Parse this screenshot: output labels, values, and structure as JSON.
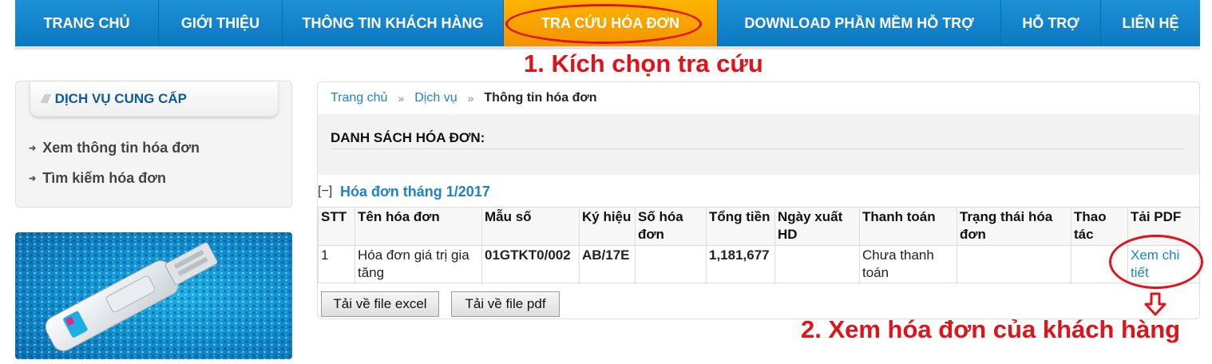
{
  "nav": {
    "items": [
      {
        "label": "TRANG CHỦ"
      },
      {
        "label": "GIỚI THIỆU"
      },
      {
        "label": "THÔNG TIN KHÁCH HÀNG"
      },
      {
        "label": "TRA CỨU HÓA ĐƠN"
      },
      {
        "label": "DOWNLOAD PHẦN MỀM HỖ TRỢ"
      },
      {
        "label": "HỖ TRỢ"
      },
      {
        "label": "LIÊN HỆ"
      }
    ],
    "active_index": 3
  },
  "annotations": {
    "step1": "1. Kích chọn tra cứu",
    "step2": "2. Xem hóa đơn của khách hàng",
    "color": "#e0131b"
  },
  "sidebar": {
    "title": "DỊCH VỤ CUNG CẤP",
    "items": [
      {
        "label": "Xem thông tin hóa đơn"
      },
      {
        "label": "Tìm kiếm hóa đơn"
      }
    ]
  },
  "breadcrumb": {
    "home": "Trang chủ",
    "service": "Dịch vụ",
    "current": "Thông tin hóa đơn",
    "separator": "»"
  },
  "invoice_list": {
    "title": "DANH SÁCH HÓA ĐƠN:",
    "group_toggle": "[−]",
    "group_title": "Hóa đơn tháng 1/2017",
    "columns": [
      "STT",
      "Tên hóa đơn",
      "Mẫu số",
      "Ký hiệu",
      "Số hóa đơn",
      "Tổng tiền",
      "Ngày xuất HD",
      "Thanh toán",
      "Trạng thái hóa đơn",
      "Thao tác",
      "Tải PDF"
    ],
    "rows": [
      {
        "stt": "1",
        "name": "Hóa đơn giá trị gia tăng",
        "form": "01GTKT0/002",
        "symbol": "AB/17E",
        "number": "",
        "total": "1,181,677",
        "issue_date": "",
        "payment": "Chưa thanh toán",
        "status": "",
        "action": "",
        "pdf_link": "Xem chi tiết"
      }
    ]
  },
  "buttons": {
    "excel": "Tải về file excel",
    "pdf": "Tải về file pdf"
  },
  "colors": {
    "nav_blue": "#0b78c2",
    "nav_active": "#f39200",
    "link_blue": "#1e82cf",
    "heading_blue": "#0a5ba3"
  }
}
